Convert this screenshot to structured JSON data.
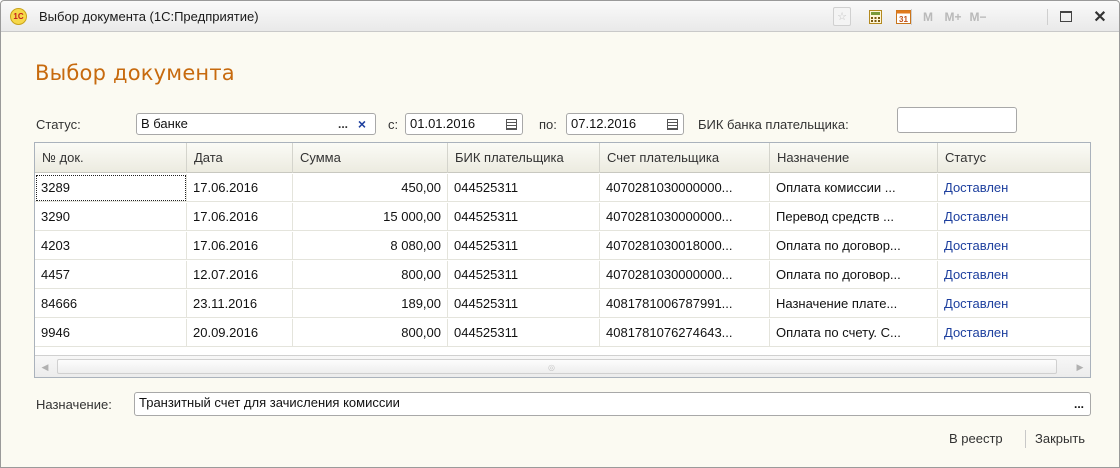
{
  "window": {
    "title": "Выбор документа  (1С:Предприятие)",
    "logo_text": "1С",
    "toolbar": {
      "m": "M",
      "mplus": "M+",
      "mminus": "M−"
    }
  },
  "heading": "Выбор документа",
  "filters": {
    "status_label": "Статус:",
    "status_value": "В банке",
    "status_select_btn": "...",
    "status_clear_btn": "×",
    "from_label": "с:",
    "from_value": "01.01.2016",
    "to_label": "по:",
    "to_value": "07.12.2016",
    "bik_label": "БИК банка плательщика:",
    "bik_value": ""
  },
  "table": {
    "columns": [
      "№ док.",
      "Дата",
      "Сумма",
      "БИК плательщика",
      "Счет плательщика",
      "Назначение",
      "Статус"
    ],
    "rows": [
      [
        "3289",
        "17.06.2016",
        "450,00",
        "044525311",
        "4070281030000000...",
        "Оплата комиссии ...",
        "Доставлен"
      ],
      [
        "3290",
        "17.06.2016",
        "15 000,00",
        "044525311",
        "4070281030000000...",
        "Перевод средств ...",
        "Доставлен"
      ],
      [
        "4203",
        "17.06.2016",
        "8 080,00",
        "044525311",
        "4070281030018000...",
        "Оплата по договор...",
        "Доставлен"
      ],
      [
        "4457",
        "12.07.2016",
        "800,00",
        "044525311",
        "4070281030000000...",
        "Оплата по договор...",
        "Доставлен"
      ],
      [
        "84666",
        "23.11.2016",
        "189,00",
        "044525311",
        "4081781006787991...",
        "Назначение плате...",
        "Доставлен"
      ],
      [
        "9946",
        "20.09.2016",
        "800,00",
        "044525311",
        "4081781076274643...",
        "Оплата по счету. С...",
        "Доставлен"
      ]
    ]
  },
  "purpose": {
    "label": "Назначение:",
    "value": "Транзитный счет для зачисления комиссии",
    "select_btn": "..."
  },
  "footer": {
    "to_registry": "В реестр",
    "close": "Закрыть"
  },
  "colors": {
    "heading": "#c76a0e",
    "status_link": "#1d3f9e",
    "background": "#fbfaf2"
  }
}
